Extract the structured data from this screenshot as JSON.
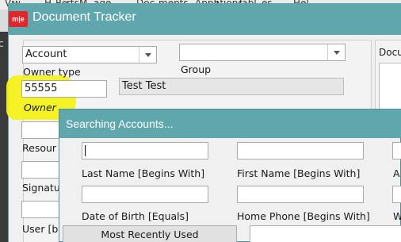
{
  "behind_menu": {
    "items": [
      "Vi",
      "w",
      "H",
      "Re",
      "rts",
      "M",
      "age",
      "Doc",
      "ments",
      "Appli",
      "ations",
      "Tabl",
      "es",
      "Hel"
    ]
  },
  "behind_left_char": "c",
  "dt_window": {
    "title": "Document Tracker",
    "icon_text": "m|e",
    "account_combo_value": "Account",
    "group_combo_value": "",
    "group_label": "Group",
    "owner_type_label": "Owner type",
    "owner_id_value": "55555",
    "owner_name_value": "Test Test",
    "owner_italic_label": "Owner",
    "resource_label": "Resour",
    "signature_label": "Signatu",
    "user_label": "User [b",
    "right_panel_label": "Docum"
  },
  "dialog": {
    "title": "Searching Accounts...",
    "last_name_label": "Last Name [Begins With]",
    "first_name_label": "First Name [Begins With]",
    "third_col_label_1": "A",
    "dob_label": "Date of Birth [Equals]",
    "home_phone_label": "Home Phone [Begins With]",
    "third_col_label_2": "W",
    "most_recent_button": "Most Recently Used"
  },
  "colors": {
    "titlebar": "#5fa6ad",
    "highlight": "#f4f21a",
    "app_icon": "#e0282a"
  }
}
